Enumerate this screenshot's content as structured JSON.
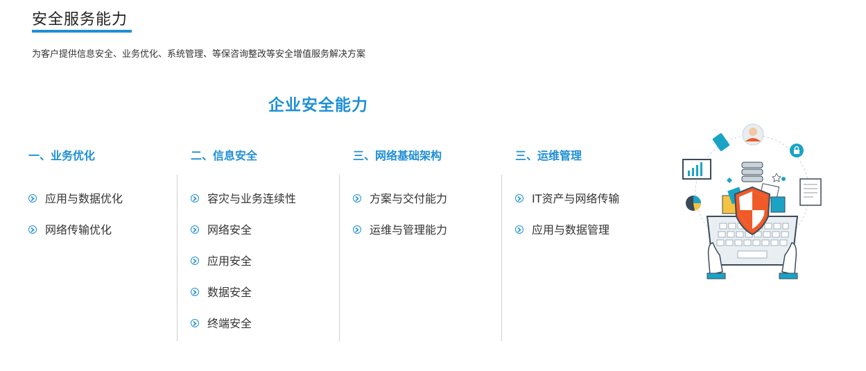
{
  "header": {
    "title": "安全服务能力",
    "subtitle": "为客户提供信息安全、业务优化、系统管理、等保咨询整改等安全增值服务解决方案"
  },
  "section": {
    "title": "企业安全能力"
  },
  "columns": [
    {
      "heading": "一、业务优化",
      "items": [
        "应用与数据优化",
        "网络传输优化"
      ]
    },
    {
      "heading": "二、信息安全",
      "items": [
        "容灾与业务连续性",
        "网络安全",
        "应用安全",
        "数据安全",
        "终端安全"
      ]
    },
    {
      "heading": "三、网络基础架构",
      "items": [
        "方案与交付能力",
        "运维与管理能力"
      ]
    },
    {
      "heading": "三、运维管理",
      "items": [
        "IT资产与网络传输",
        "应用与数据管理"
      ]
    }
  ],
  "colors": {
    "accent": "#1e8fd5",
    "shield_orange": "#f05a28"
  },
  "icons": {
    "bullet": "chevron-right-circle-icon",
    "illustration": "security-shield-keyboard-illustration"
  }
}
